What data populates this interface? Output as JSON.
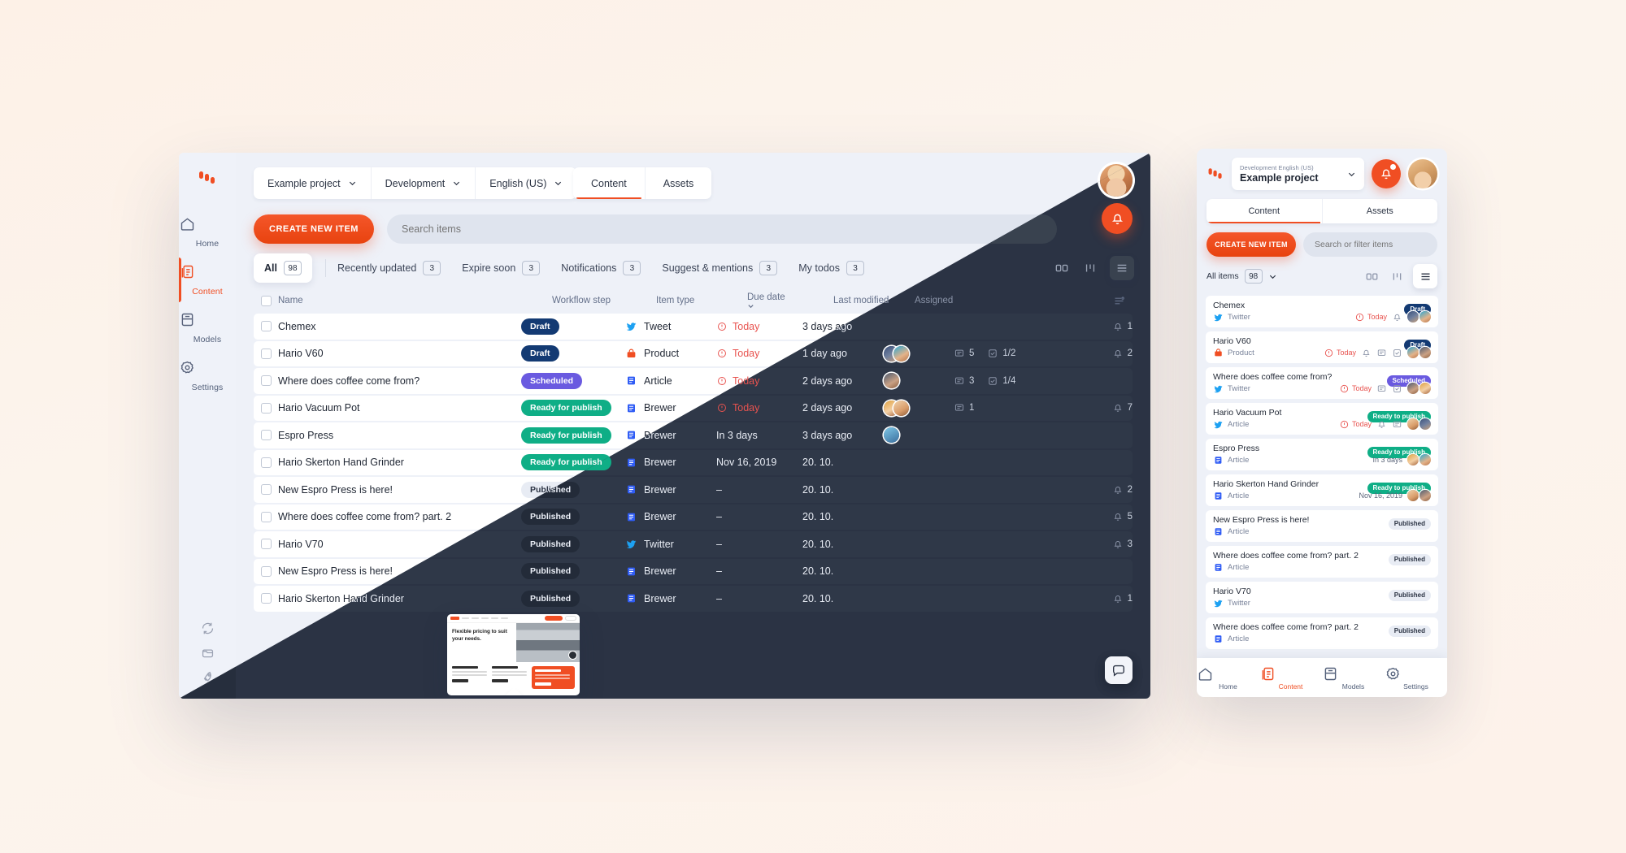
{
  "brand": {
    "accent": "#f04e23",
    "dark_panel": "#2b3344",
    "draft": "#133a73",
    "scheduled": "#6a5ae0",
    "ready": "#0fae86",
    "published_bg": "#e8ecf4",
    "overdue": "#e8534f"
  },
  "desktop": {
    "selectors": [
      {
        "label": "Example project",
        "icon": "chevron-down-icon"
      },
      {
        "label": "Development",
        "icon": "chevron-down-icon"
      },
      {
        "label": "English (US)",
        "icon": "chevron-down-icon"
      }
    ],
    "tabs": [
      {
        "label": "Content",
        "active": true
      },
      {
        "label": "Assets",
        "active": false
      }
    ],
    "create_label": "CREATE NEW ITEM",
    "search_placeholder": "Search items",
    "filters": [
      {
        "label": "All",
        "count": "98",
        "active": true
      },
      {
        "label": "Recently updated",
        "count": "3",
        "active": false
      },
      {
        "label": "Expire soon",
        "count": "3",
        "active": false
      },
      {
        "label": "Notifications",
        "count": "3",
        "active": false
      },
      {
        "label": "Suggest & mentions",
        "count": "3",
        "active": false
      },
      {
        "label": "My todos",
        "count": "3",
        "active": false
      }
    ],
    "view_icons": [
      "grid-view-icon",
      "board-view-icon",
      "list-view-icon"
    ],
    "columns": {
      "name": "Name",
      "workflow_step": "Workflow step",
      "item_type": "Item type",
      "due_date": "Due date",
      "last_modified": "Last modified",
      "assigned": "Assigned",
      "settings": "column-settings-icon"
    },
    "rows": [
      {
        "name": "Chemex",
        "workflow": "Draft",
        "workflow_kind": "draft",
        "type": "Tweet",
        "type_icon": "twitter-icon",
        "due": "Today",
        "due_late": true,
        "modified": "3 days ago",
        "avatars": [],
        "comments": "",
        "tasks": "",
        "bell": "1"
      },
      {
        "name": "Hario V60",
        "workflow": "Draft",
        "workflow_kind": "draft",
        "type": "Product",
        "type_icon": "product-bag-icon",
        "due": "Today",
        "due_late": true,
        "modified": "1 day ago",
        "avatars": [
          "avA",
          "avB"
        ],
        "comments": "5",
        "tasks": "1/2",
        "bell": "2"
      },
      {
        "name": "Where does coffee come from?",
        "workflow": "Scheduled",
        "workflow_kind": "scheduled",
        "type": "Article",
        "type_icon": "article-icon",
        "due": "Today",
        "due_late": true,
        "modified": "2 days ago",
        "avatars": [
          "avC"
        ],
        "comments": "3",
        "tasks": "1/4",
        "bell": ""
      },
      {
        "name": "Hario Vacuum Pot",
        "workflow": "Ready for publish",
        "workflow_kind": "ready",
        "type": "Brewer",
        "type_icon": "article-icon",
        "due": "Today",
        "due_late": true,
        "modified": "2 days ago",
        "avatars": [
          "avD",
          "avE"
        ],
        "comments": "1",
        "tasks": "",
        "bell": "7"
      },
      {
        "name": "Espro Press",
        "workflow": "Ready for publish",
        "workflow_kind": "ready",
        "type": "Brewer",
        "type_icon": "article-icon",
        "due": "In 3 days",
        "due_late": false,
        "modified": "3 days ago",
        "avatars": [
          "avF"
        ],
        "comments": "",
        "tasks": "",
        "bell": ""
      },
      {
        "name": "Hario Skerton Hand Grinder",
        "workflow": "Ready for publish",
        "workflow_kind": "ready",
        "type": "Brewer",
        "type_icon": "article-icon",
        "due": "Nov 16, 2019",
        "due_late": false,
        "modified": "20. 10.",
        "avatars": [],
        "comments": "",
        "tasks": "",
        "bell": ""
      },
      {
        "name": "New Espro Press is here!",
        "workflow": "Published",
        "workflow_kind": "published",
        "type": "Brewer",
        "type_icon": "article-icon",
        "due": "–",
        "due_late": false,
        "modified": "20. 10.",
        "avatars": [],
        "comments": "",
        "tasks": "",
        "bell": "2"
      },
      {
        "name": "Where does coffee come from? part. 2",
        "workflow": "Published",
        "workflow_kind": "published",
        "type": "Brewer",
        "type_icon": "article-icon",
        "due": "–",
        "due_late": false,
        "modified": "20. 10.",
        "avatars": [],
        "comments": "",
        "tasks": "",
        "bell": "5"
      },
      {
        "name": "Hario V70",
        "workflow": "Published",
        "workflow_kind": "published",
        "type": "Twitter",
        "type_icon": "twitter-icon",
        "due": "–",
        "due_late": false,
        "modified": "20. 10.",
        "avatars": [],
        "comments": "",
        "tasks": "",
        "bell": "3"
      },
      {
        "name": "New Espro Press is here!",
        "workflow": "Published",
        "workflow_kind": "published",
        "type": "Brewer",
        "type_icon": "article-icon",
        "due": "–",
        "due_late": false,
        "modified": "20. 10.",
        "avatars": [],
        "comments": "",
        "tasks": "",
        "bell": ""
      },
      {
        "name": "Hario Skerton Hand Grinder",
        "workflow": "Published",
        "workflow_kind": "published",
        "type": "Brewer",
        "type_icon": "article-icon",
        "due": "–",
        "due_late": false,
        "modified": "20. 10.",
        "avatars": [],
        "comments": "",
        "tasks": "",
        "bell": "1"
      }
    ],
    "sidebar": [
      {
        "label": "Home",
        "icon": "home-icon",
        "active": false
      },
      {
        "label": "Content",
        "icon": "content-pages-icon",
        "active": true
      },
      {
        "label": "Models",
        "icon": "models-icon",
        "active": false
      },
      {
        "label": "Settings",
        "icon": "gear-icon",
        "active": false
      }
    ],
    "sidebar_bottom": [
      "sync-icon",
      "archive-icon",
      "rocket-icon"
    ],
    "preview_card": {
      "heading": "Flexible pricing to suit your needs.",
      "plans": [
        "Starter",
        "Business",
        "Enterprise"
      ]
    },
    "chat_icon": "chat-bubble-icon",
    "bell_fab_icon": "bell-icon"
  },
  "mobile": {
    "project": {
      "context": "Development  English (US)",
      "name": "Example project"
    },
    "bell_icon": "bell-icon",
    "avatar": "user-avatar",
    "tabs": [
      {
        "label": "Content",
        "active": true
      },
      {
        "label": "Assets",
        "active": false
      }
    ],
    "create_label": "CREATE NEW ITEM",
    "search_placeholder": "Search or filter items",
    "filter": {
      "label": "All items",
      "count": "98",
      "chevron": "chevron-down-icon"
    },
    "view_icons": [
      "grid-view-icon",
      "board-view-icon",
      "list-view-icon"
    ],
    "rows": [
      {
        "title": "Chemex",
        "type": "Twitter",
        "type_icon": "twitter-icon",
        "badge": "Draft",
        "badge_kind": "draft",
        "due": "Today",
        "due_late": true,
        "icons": [
          "bell-icon"
        ],
        "avatars": [
          "avA",
          "avB"
        ]
      },
      {
        "title": "Hario V60",
        "type": "Product",
        "type_icon": "product-bag-icon",
        "badge": "Draft",
        "badge_kind": "draft",
        "due": "Today",
        "due_late": true,
        "icons": [
          "bell-icon",
          "comment-icon",
          "task-icon"
        ],
        "avatars": [
          "avB",
          "avC"
        ]
      },
      {
        "title": "Where does coffee come from?",
        "type": "Twitter",
        "type_icon": "twitter-icon",
        "badge": "Scheduled",
        "badge_kind": "scheduled",
        "due": "Today",
        "due_late": true,
        "icons": [
          "comment-icon",
          "task-icon"
        ],
        "avatars": [
          "avC",
          "avD"
        ]
      },
      {
        "title": "Hario Vacuum Pot",
        "type": "Article",
        "type_icon": "twitter-icon",
        "badge": "Ready to publish",
        "badge_kind": "ready",
        "due": "Today",
        "due_late": true,
        "icons": [
          "bell-icon",
          "comment-icon"
        ],
        "avatars": [
          "avE",
          "avA"
        ]
      },
      {
        "title": "Espro Press",
        "type": "Article",
        "type_icon": "article-icon",
        "badge": "Ready to publish",
        "badge_kind": "ready",
        "due": "In 3 days",
        "due_late": false,
        "icons": [],
        "avatars": [
          "avD",
          "avB"
        ]
      },
      {
        "title": "Hario Skerton Hand Grinder",
        "type": "Article",
        "type_icon": "article-icon",
        "badge": "Ready to publish",
        "badge_kind": "ready",
        "due": "Nov 16, 2019",
        "due_late": false,
        "icons": [],
        "avatars": [
          "avE",
          "avC"
        ]
      },
      {
        "title": "New Espro Press is here!",
        "type": "Article",
        "type_icon": "article-icon",
        "badge": "Published",
        "badge_kind": "published",
        "due": "",
        "due_late": false,
        "icons": [],
        "avatars": []
      },
      {
        "title": "Where does coffee come from? part. 2",
        "type": "Article",
        "type_icon": "article-icon",
        "badge": "Published",
        "badge_kind": "published",
        "due": "",
        "due_late": false,
        "icons": [],
        "avatars": []
      },
      {
        "title": "Hario V70",
        "type": "Twitter",
        "type_icon": "twitter-icon",
        "badge": "Published",
        "badge_kind": "published",
        "due": "",
        "due_late": false,
        "icons": [],
        "avatars": []
      },
      {
        "title": "Where does coffee come from? part. 2",
        "type": "Article",
        "type_icon": "article-icon",
        "badge": "Published",
        "badge_kind": "published",
        "due": "",
        "due_late": false,
        "icons": [],
        "avatars": []
      }
    ],
    "nav": [
      {
        "label": "Home",
        "icon": "home-icon",
        "active": false
      },
      {
        "label": "Content",
        "icon": "content-pages-icon",
        "active": true
      },
      {
        "label": "Models",
        "icon": "models-icon",
        "active": false
      },
      {
        "label": "Settings",
        "icon": "gear-icon",
        "active": false
      }
    ]
  }
}
